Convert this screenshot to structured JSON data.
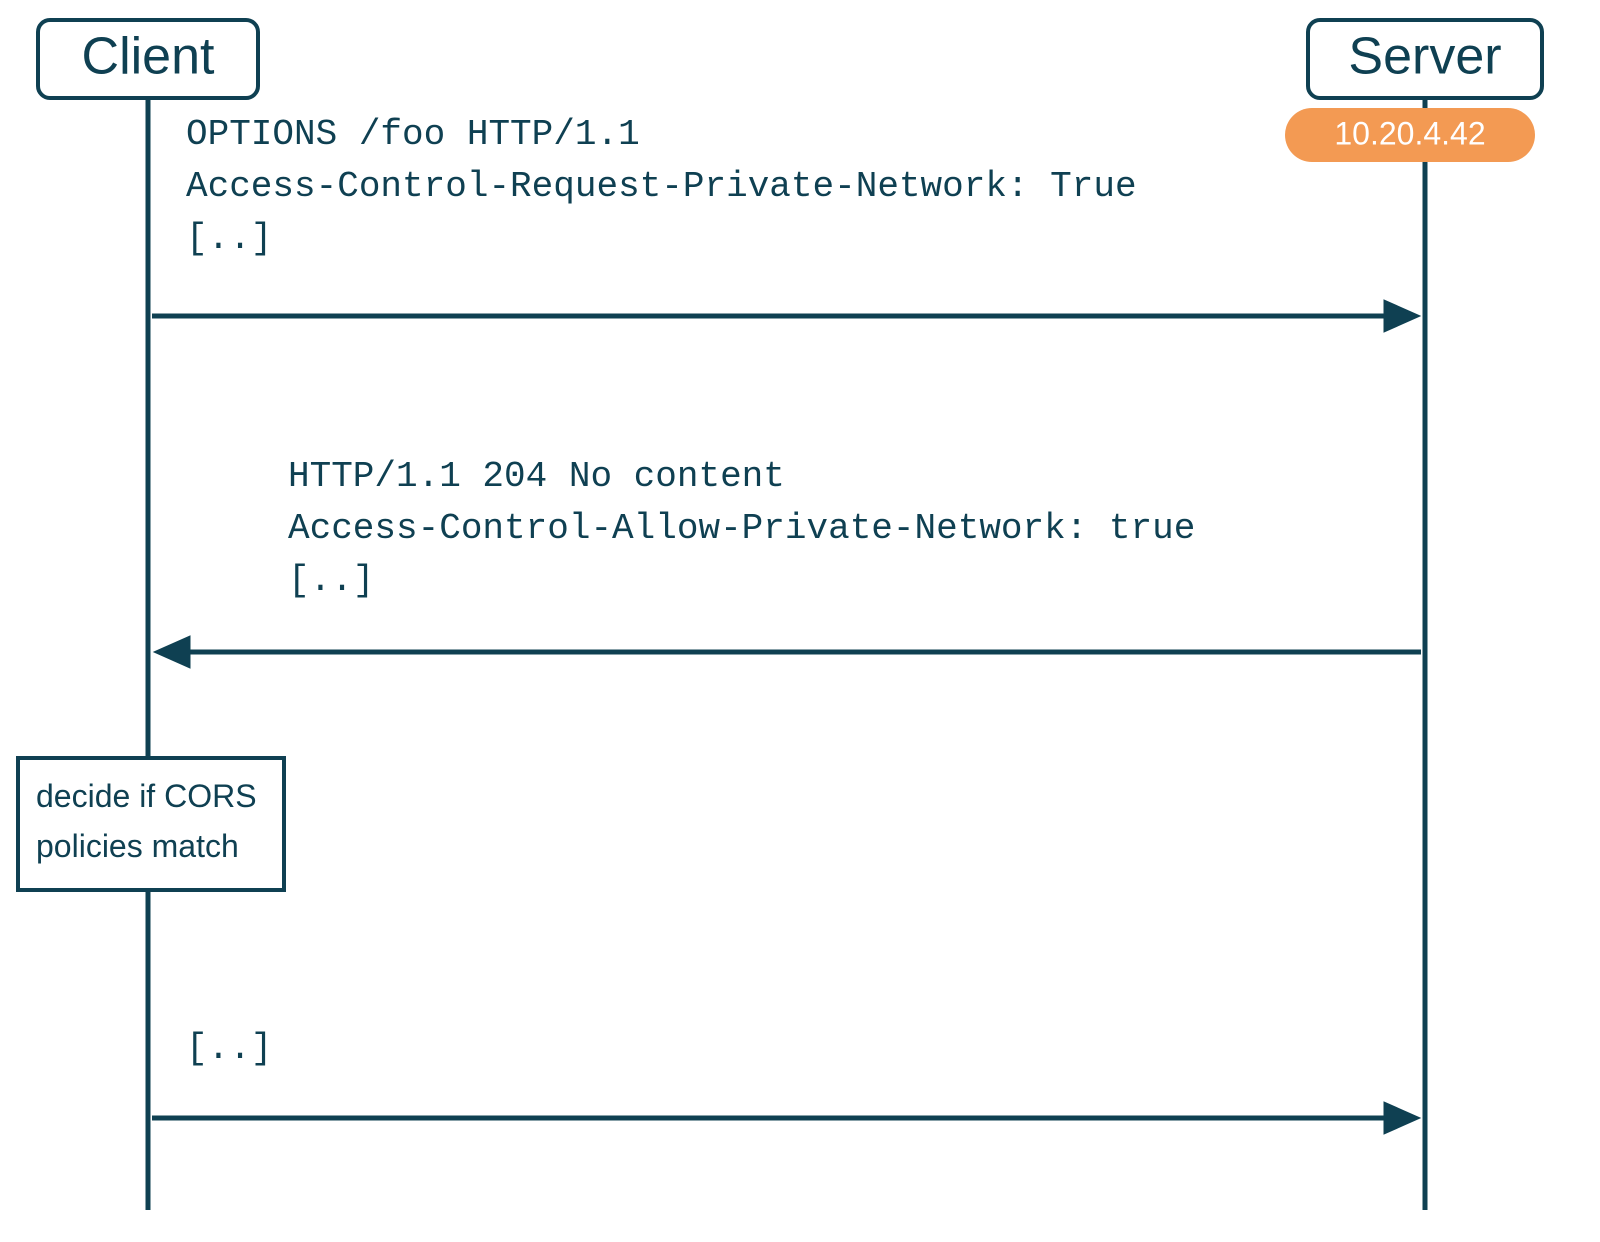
{
  "actors": {
    "client": {
      "label": "Client"
    },
    "server": {
      "label": "Server",
      "ip": "10.20.4.42"
    }
  },
  "messages": {
    "request": {
      "line1": "OPTIONS /foo HTTP/1.1",
      "line2": "Access-Control-Request-Private-Network: True",
      "line3": "[..]"
    },
    "response": {
      "line1": "HTTP/1.1 204 No content",
      "line2": "Access-Control-Allow-Private-Network: true",
      "line3": "[..]"
    },
    "followup": {
      "line1": "[..]"
    }
  },
  "notes": {
    "cors": {
      "line1": "decide if CORS",
      "line2": "policies match"
    }
  }
}
